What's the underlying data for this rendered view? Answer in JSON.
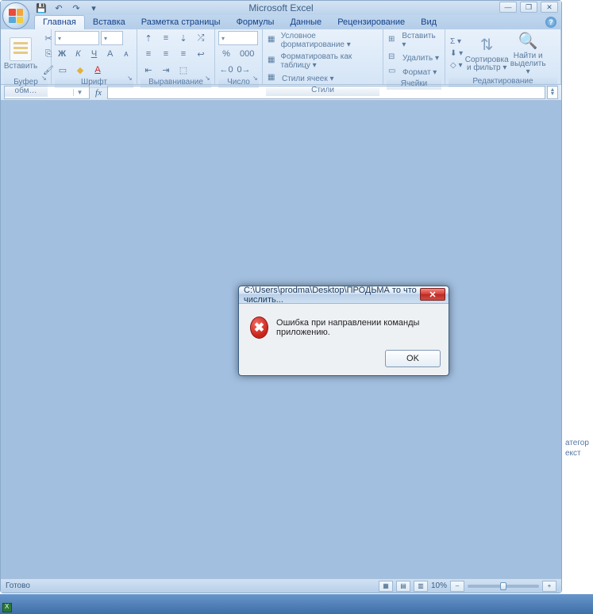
{
  "titlebar": {
    "app_title": "Microsoft Excel"
  },
  "qat": {
    "save": "💾",
    "undo": "↶",
    "redo": "↷",
    "custom": "▾"
  },
  "win": {
    "min": "―",
    "max": "❐",
    "close": "✕"
  },
  "tabs": {
    "t0": "Главная",
    "t1": "Вставка",
    "t2": "Разметка страницы",
    "t3": "Формулы",
    "t4": "Данные",
    "t5": "Рецензирование",
    "t6": "Вид"
  },
  "help_q": "?",
  "ribbon": {
    "clipboard": {
      "paste": "Вставить",
      "label": "Буфер обм…"
    },
    "font": {
      "bold": "Ж",
      "italic": "К",
      "underline": "Ч",
      "font_size": "▾",
      "grow": "A",
      "shrink": "ᴀ",
      "border": "▭",
      "fill": "◆",
      "color": "A",
      "label": "Шрифт"
    },
    "align": {
      "top": "⇡",
      "mid": "≡",
      "bot": "⇣",
      "left": "≡",
      "center": "≡",
      "right": "≡",
      "outdent": "⇤",
      "indent": "⇥",
      "wrap": "↩",
      "orient": "⤮",
      "merge": "⬚",
      "label": "Выравнивание"
    },
    "number": {
      "general": "%",
      "comma": "000",
      "inc": "←0",
      "dec": "0→",
      "label": "Число",
      "format": "▾"
    },
    "styles": {
      "cond": "Условное форматирование ▾",
      "table": "Форматировать как таблицу ▾",
      "cells": "Стили ячеек ▾",
      "label": "Стили"
    },
    "cells": {
      "insert": "Вставить ▾",
      "delete": "Удалить ▾",
      "format": "Формат ▾",
      "label": "Ячейки"
    },
    "editing": {
      "sum": "Σ ▾",
      "fill": "⬇ ▾",
      "clear": "◇ ▾",
      "sort": "Сортировка и фильтр ▾",
      "find": "Найти и выделить ▾",
      "label": "Редактирование"
    }
  },
  "formulabar": {
    "namebox": "",
    "fx": "fx"
  },
  "statusbar": {
    "ready": "Готово",
    "zoom": "10%",
    "plus": "+",
    "minus": "–"
  },
  "dialog": {
    "title": "C:\\Users\\prodma\\Desktop\\ПРОДЬМА  то что числить...",
    "message": "Ошибка при направлении команды приложению.",
    "icon": "✖",
    "ok": "OK",
    "close": "✕"
  },
  "behind": {
    "l1": "атегор",
    "l2": "екст"
  }
}
